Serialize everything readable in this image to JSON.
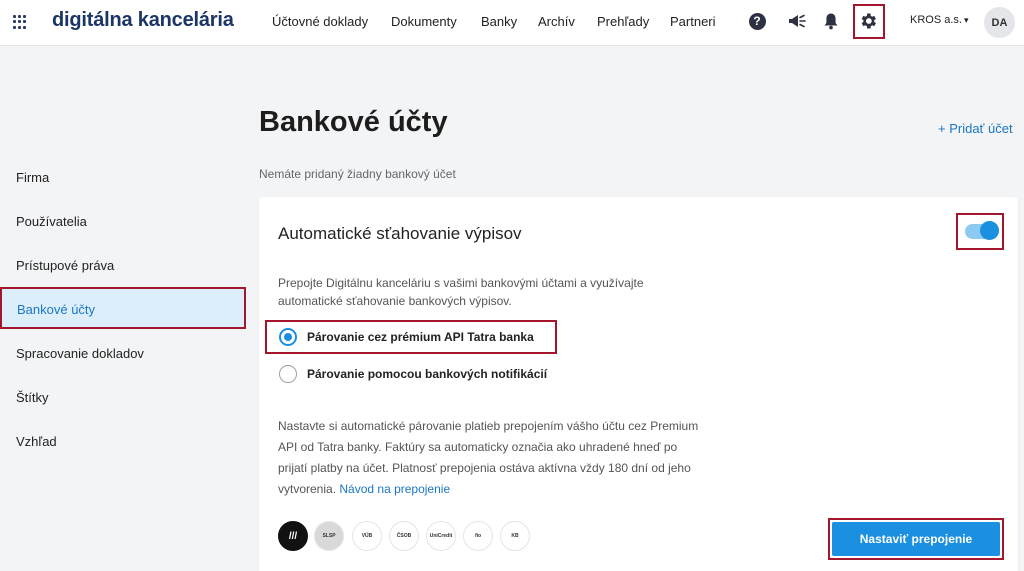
{
  "app": {
    "title": "digitálna kancelária"
  },
  "nav": {
    "items": [
      {
        "label": "Účtovné doklady"
      },
      {
        "label": "Dokumenty"
      },
      {
        "label": "Banky"
      },
      {
        "label": "Archív"
      },
      {
        "label": "Prehľady"
      },
      {
        "label": "Partneri"
      }
    ]
  },
  "header": {
    "help_glyph": "?",
    "account_label": "KROS a.s.",
    "account_chevron": "▾",
    "avatar_initials": "DA",
    "icons": [
      "apps-grid-icon",
      "help-icon",
      "megaphone-icon",
      "bell-icon",
      "gear-icon"
    ]
  },
  "sidebar": {
    "items": [
      {
        "label": "Firma"
      },
      {
        "label": "Používatelia"
      },
      {
        "label": "Prístupové práva"
      },
      {
        "label": "Bankové účty"
      },
      {
        "label": "Spracovanie dokladov"
      },
      {
        "label": "Štítky"
      },
      {
        "label": "Vzhľad"
      }
    ],
    "active_index": 3
  },
  "main": {
    "title": "Bankové účty",
    "add_account": "+ Pridať účet",
    "empty_note": "Nemáte pridaný žiadny bankový účet",
    "card": {
      "title": "Automatické sťahovanie výpisov",
      "toggle_on": true,
      "description": "Prepojte Digitálnu kanceláriu s vašimi bankovými účtami a využívajte automatické sťahovanie bankových výpisov.",
      "options": [
        {
          "label": "Párovanie cez prémium API Tatra banka",
          "selected": true
        },
        {
          "label": "Párovanie pomocou bankových notifikácií",
          "selected": false
        }
      ],
      "info_text": "Nastavte si automatické párovanie platieb prepojením vášho účtu cez Premium API od Tatra banky. Faktúry sa automaticky označia ako uhradené hneď po prijatí platby na účet. Platnosť prepojenia ostáva aktívna vždy 180 dní od jeho vytvorenia.",
      "info_link": "Návod na prepojenie",
      "bank_logos": [
        {
          "name": "tatra-banka-logo",
          "text": "///"
        },
        {
          "name": "slovenska-sporitelna-logo",
          "text": "SLSP"
        },
        {
          "name": "vub-banka-logo",
          "text": "VÚB"
        },
        {
          "name": "csob-logo",
          "text": "ČSOB"
        },
        {
          "name": "unicredit-logo",
          "text": "UniCredit"
        },
        {
          "name": "fio-banka-logo",
          "text": "fio"
        },
        {
          "name": "kb-logo",
          "text": "KB"
        }
      ],
      "button_label": "Nastaviť prepojenie"
    }
  },
  "colors": {
    "accent": "#1b8fe0",
    "link": "#1b77c5",
    "highlight_frame": "#a3162d",
    "active_bg": "#dceefa",
    "brand": "#1c3567"
  }
}
